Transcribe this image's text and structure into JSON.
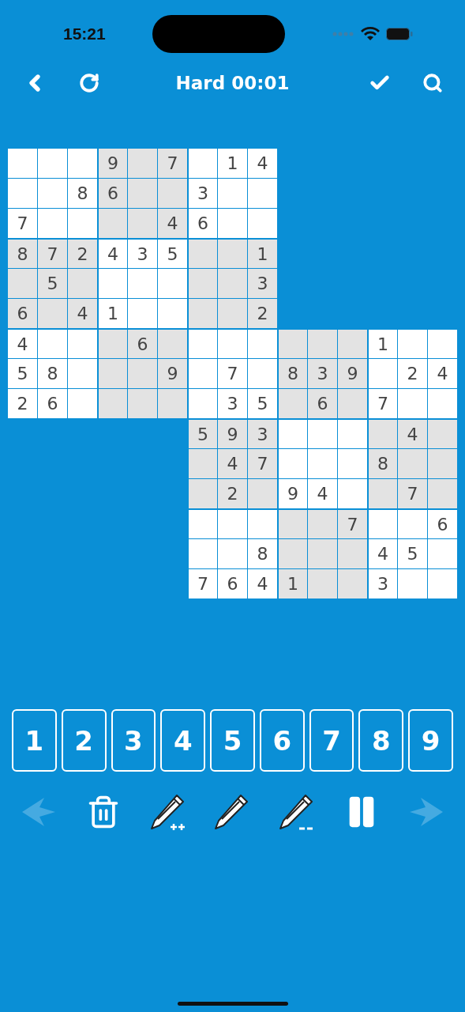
{
  "status_bar": {
    "time": "15:21"
  },
  "toolbar": {
    "title": "Hard 00:01"
  },
  "top_grid": [
    [
      {
        "kind": "blank"
      },
      {
        "kind": "blank"
      },
      {
        "kind": "blank"
      },
      {
        "kind": "given",
        "digit": "9"
      },
      {
        "kind": "blank"
      },
      {
        "kind": "given",
        "digit": "7"
      },
      {
        "kind": "blank"
      },
      {
        "kind": "given",
        "digit": "1"
      },
      {
        "kind": "given",
        "digit": "4"
      }
    ],
    [
      {
        "kind": "blank"
      },
      {
        "kind": "blank"
      },
      {
        "kind": "given",
        "digit": "8"
      },
      {
        "kind": "given",
        "digit": "6"
      },
      {
        "kind": "blank"
      },
      {
        "kind": "blank"
      },
      {
        "kind": "given",
        "digit": "3"
      },
      {
        "kind": "blank"
      },
      {
        "kind": "blank"
      }
    ],
    [
      {
        "kind": "given",
        "digit": "7"
      },
      {
        "kind": "blank"
      },
      {
        "kind": "blank"
      },
      {
        "kind": "blank"
      },
      {
        "kind": "blank"
      },
      {
        "kind": "given",
        "digit": "4"
      },
      {
        "kind": "given",
        "digit": "6"
      },
      {
        "kind": "blank"
      },
      {
        "kind": "blank"
      }
    ],
    [
      {
        "kind": "given",
        "digit": "8"
      },
      {
        "kind": "given",
        "digit": "7"
      },
      {
        "kind": "given",
        "digit": "2"
      },
      {
        "kind": "given",
        "digit": "4"
      },
      {
        "kind": "given",
        "digit": "3"
      },
      {
        "kind": "given",
        "digit": "5"
      },
      {
        "kind": "blank"
      },
      {
        "kind": "blank"
      },
      {
        "kind": "given",
        "digit": "1"
      }
    ],
    [
      {
        "kind": "blank"
      },
      {
        "kind": "given",
        "digit": "5"
      },
      {
        "kind": "blank"
      },
      {
        "kind": "blank"
      },
      {
        "kind": "blank"
      },
      {
        "kind": "blank"
      },
      {
        "kind": "blank"
      },
      {
        "kind": "blank"
      },
      {
        "kind": "given",
        "digit": "3"
      }
    ],
    [
      {
        "kind": "given",
        "digit": "6"
      },
      {
        "kind": "blank"
      },
      {
        "kind": "given",
        "digit": "4"
      },
      {
        "kind": "given",
        "digit": "1"
      },
      {
        "kind": "blank"
      },
      {
        "kind": "blank"
      },
      {
        "kind": "blank"
      },
      {
        "kind": "blank"
      },
      {
        "kind": "given",
        "digit": "2"
      }
    ],
    [
      {
        "kind": "given",
        "digit": "4"
      },
      {
        "kind": "blank"
      },
      {
        "kind": "blank"
      },
      {
        "kind": "blank"
      },
      {
        "kind": "given",
        "digit": "6"
      },
      {
        "kind": "blank"
      },
      {
        "kind": "blank"
      },
      {
        "kind": "blank"
      },
      {
        "kind": "blank"
      }
    ],
    [
      {
        "kind": "given",
        "digit": "5"
      },
      {
        "kind": "given",
        "digit": "8"
      },
      {
        "kind": "blank"
      },
      {
        "kind": "blank"
      },
      {
        "kind": "blank"
      },
      {
        "kind": "given",
        "digit": "9"
      },
      {
        "kind": "blank"
      },
      {
        "kind": "given",
        "digit": "7"
      },
      {
        "kind": "blank"
      }
    ],
    [
      {
        "kind": "given",
        "digit": "2"
      },
      {
        "kind": "given",
        "digit": "6"
      },
      {
        "kind": "blank"
      },
      {
        "kind": "blank"
      },
      {
        "kind": "blank"
      },
      {
        "kind": "blank"
      },
      {
        "kind": "blank"
      },
      {
        "kind": "given",
        "digit": "3"
      },
      {
        "kind": "given",
        "digit": "5"
      }
    ]
  ],
  "bottom_grid": [
    [
      {
        "kind": "blank"
      },
      {
        "kind": "blank"
      },
      {
        "kind": "blank"
      },
      {
        "kind": "given",
        "digit": "1"
      },
      {
        "kind": "blank"
      },
      {
        "kind": "blank"
      }
    ],
    [
      {
        "kind": "given",
        "digit": "8"
      },
      {
        "kind": "given",
        "digit": "3"
      },
      {
        "kind": "given",
        "digit": "9"
      },
      {
        "kind": "blank"
      },
      {
        "kind": "given",
        "digit": "2"
      },
      {
        "kind": "given",
        "digit": "4"
      }
    ],
    [
      {
        "kind": "blank"
      },
      {
        "kind": "given",
        "digit": "6"
      },
      {
        "kind": "blank"
      },
      {
        "kind": "given",
        "digit": "7"
      },
      {
        "kind": "blank"
      },
      {
        "kind": "blank"
      }
    ],
    [
      {
        "kind": "given",
        "digit": "5"
      },
      {
        "kind": "given",
        "digit": "9"
      },
      {
        "kind": "given",
        "digit": "3"
      },
      {
        "kind": "blank"
      },
      {
        "kind": "blank"
      },
      {
        "kind": "blank"
      },
      {
        "kind": "blank"
      },
      {
        "kind": "given",
        "digit": "4"
      },
      {
        "kind": "blank"
      }
    ],
    [
      {
        "kind": "blank"
      },
      {
        "kind": "given",
        "digit": "4"
      },
      {
        "kind": "given",
        "digit": "7"
      },
      {
        "kind": "blank"
      },
      {
        "kind": "blank"
      },
      {
        "kind": "blank"
      },
      {
        "kind": "given",
        "digit": "8"
      },
      {
        "kind": "blank"
      },
      {
        "kind": "blank"
      }
    ],
    [
      {
        "kind": "blank"
      },
      {
        "kind": "given",
        "digit": "2"
      },
      {
        "kind": "blank"
      },
      {
        "kind": "given",
        "digit": "9"
      },
      {
        "kind": "given",
        "digit": "4"
      },
      {
        "kind": "blank"
      },
      {
        "kind": "blank"
      },
      {
        "kind": "given",
        "digit": "7"
      },
      {
        "kind": "blank"
      }
    ],
    [
      {
        "kind": "blank"
      },
      {
        "kind": "blank"
      },
      {
        "kind": "blank"
      },
      {
        "kind": "blank"
      },
      {
        "kind": "blank"
      },
      {
        "kind": "given",
        "digit": "7"
      },
      {
        "kind": "blank"
      },
      {
        "kind": "blank"
      },
      {
        "kind": "given",
        "digit": "6"
      }
    ],
    [
      {
        "kind": "blank"
      },
      {
        "kind": "blank"
      },
      {
        "kind": "given",
        "digit": "8"
      },
      {
        "kind": "blank"
      },
      {
        "kind": "blank"
      },
      {
        "kind": "blank"
      },
      {
        "kind": "given",
        "digit": "4"
      },
      {
        "kind": "given",
        "digit": "5"
      },
      {
        "kind": "blank"
      }
    ],
    [
      {
        "kind": "given",
        "digit": "7"
      },
      {
        "kind": "given",
        "digit": "6"
      },
      {
        "kind": "given",
        "digit": "4"
      },
      {
        "kind": "given",
        "digit": "1"
      },
      {
        "kind": "blank"
      },
      {
        "kind": "blank"
      },
      {
        "kind": "given",
        "digit": "3"
      },
      {
        "kind": "blank"
      },
      {
        "kind": "blank"
      }
    ]
  ],
  "number_pad": [
    "1",
    "2",
    "3",
    "4",
    "5",
    "6",
    "7",
    "8",
    "9"
  ],
  "tools": [
    {
      "kind": "undo",
      "disabled": true
    },
    {
      "kind": "delete",
      "disabled": false
    },
    {
      "kind": "add-notes",
      "disabled": false
    },
    {
      "kind": "pencil",
      "disabled": false
    },
    {
      "kind": "remove-notes",
      "disabled": false
    },
    {
      "kind": "pause",
      "disabled": false
    },
    {
      "kind": "redo",
      "disabled": true
    }
  ]
}
